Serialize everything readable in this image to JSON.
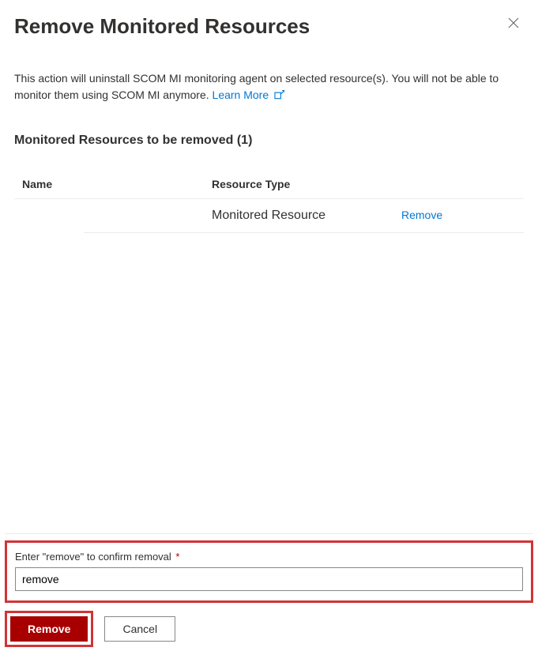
{
  "header": {
    "title": "Remove Monitored Resources"
  },
  "description": {
    "text": "This action will uninstall SCOM MI monitoring agent on selected resource(s). You will not be able to monitor them using SCOM MI anymore. ",
    "learn_more_label": "Learn More"
  },
  "section": {
    "title": "Monitored Resources to be removed (1)"
  },
  "table": {
    "headers": {
      "name": "Name",
      "type": "Resource Type"
    },
    "rows": [
      {
        "name": "",
        "type": "Monitored Resource",
        "action_label": "Remove"
      }
    ]
  },
  "confirm": {
    "label": "Enter \"remove\" to confirm removal",
    "required_mark": "*",
    "value": "remove"
  },
  "footer": {
    "primary_label": "Remove",
    "secondary_label": "Cancel"
  }
}
